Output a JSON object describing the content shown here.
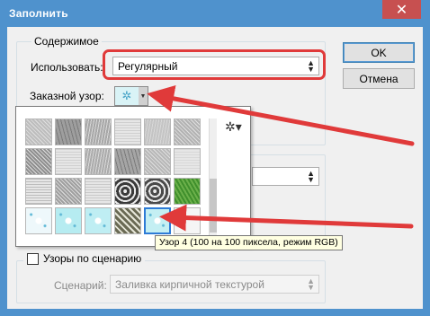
{
  "window": {
    "title": "Заполнить",
    "close_glyph": "✕"
  },
  "contents_group": {
    "legend": "Содержимое",
    "use_label": "Использовать:",
    "use_value": "Регулярный",
    "custom_pattern_label": "Заказной узор:"
  },
  "buttons": {
    "ok": "OK",
    "cancel": "Отмена"
  },
  "picker": {
    "gear_glyph": "✲▾",
    "tooltip": "Узор 4 (100 на 100 пиксела, режим RGB)",
    "patterns": [
      {
        "color": "#bdbdbd",
        "tex": "noise"
      },
      {
        "color": "#9e9e9e",
        "tex": "scratch"
      },
      {
        "color": "#a7a7a7",
        "tex": "fiber"
      },
      {
        "color": "#cfcfcf",
        "tex": "fine"
      },
      {
        "color": "#c4c4c4",
        "tex": "fiber"
      },
      {
        "color": "#b3b3b3",
        "tex": "noise"
      },
      {
        "color": "#8f8f8f",
        "tex": "noise"
      },
      {
        "color": "#d0d0d0",
        "tex": "fine"
      },
      {
        "color": "#ababab",
        "tex": "fiber"
      },
      {
        "color": "#a5a5a5",
        "tex": "scratch"
      },
      {
        "color": "#b8b8b8",
        "tex": "noise"
      },
      {
        "color": "#d8d8d8",
        "tex": "fine"
      },
      {
        "color": "#bcbcbc",
        "tex": "fine"
      },
      {
        "color": "#a0a0a0",
        "tex": "noise"
      },
      {
        "color": "#c9c9c9",
        "tex": "fine"
      },
      {
        "color": "#3a3a3a",
        "tex": "swirl"
      },
      {
        "color": "#4a4a4a",
        "tex": "swirl"
      },
      {
        "color": "#3f8f2c",
        "tex": "grass"
      },
      {
        "color": "#eef8fb",
        "tex": "snow"
      },
      {
        "color": "#b6ecf1",
        "tex": "snow"
      },
      {
        "color": "#bfeef3",
        "tex": "snow"
      },
      {
        "color": "#6a6a54",
        "tex": "weave"
      },
      {
        "color": "#c4eff3",
        "tex": "snow"
      },
      {
        "color": "#f5f5f5",
        "tex": "empty"
      }
    ]
  },
  "script_group": {
    "checkbox_label": "Узоры по сценарию",
    "script_label": "Сценарий:",
    "script_value": "Заливка кирпичной текстурой"
  },
  "colors": {
    "title_bar": "#4f92cd",
    "highlight": "#e03a3a",
    "selection": "#2d7bd6"
  }
}
